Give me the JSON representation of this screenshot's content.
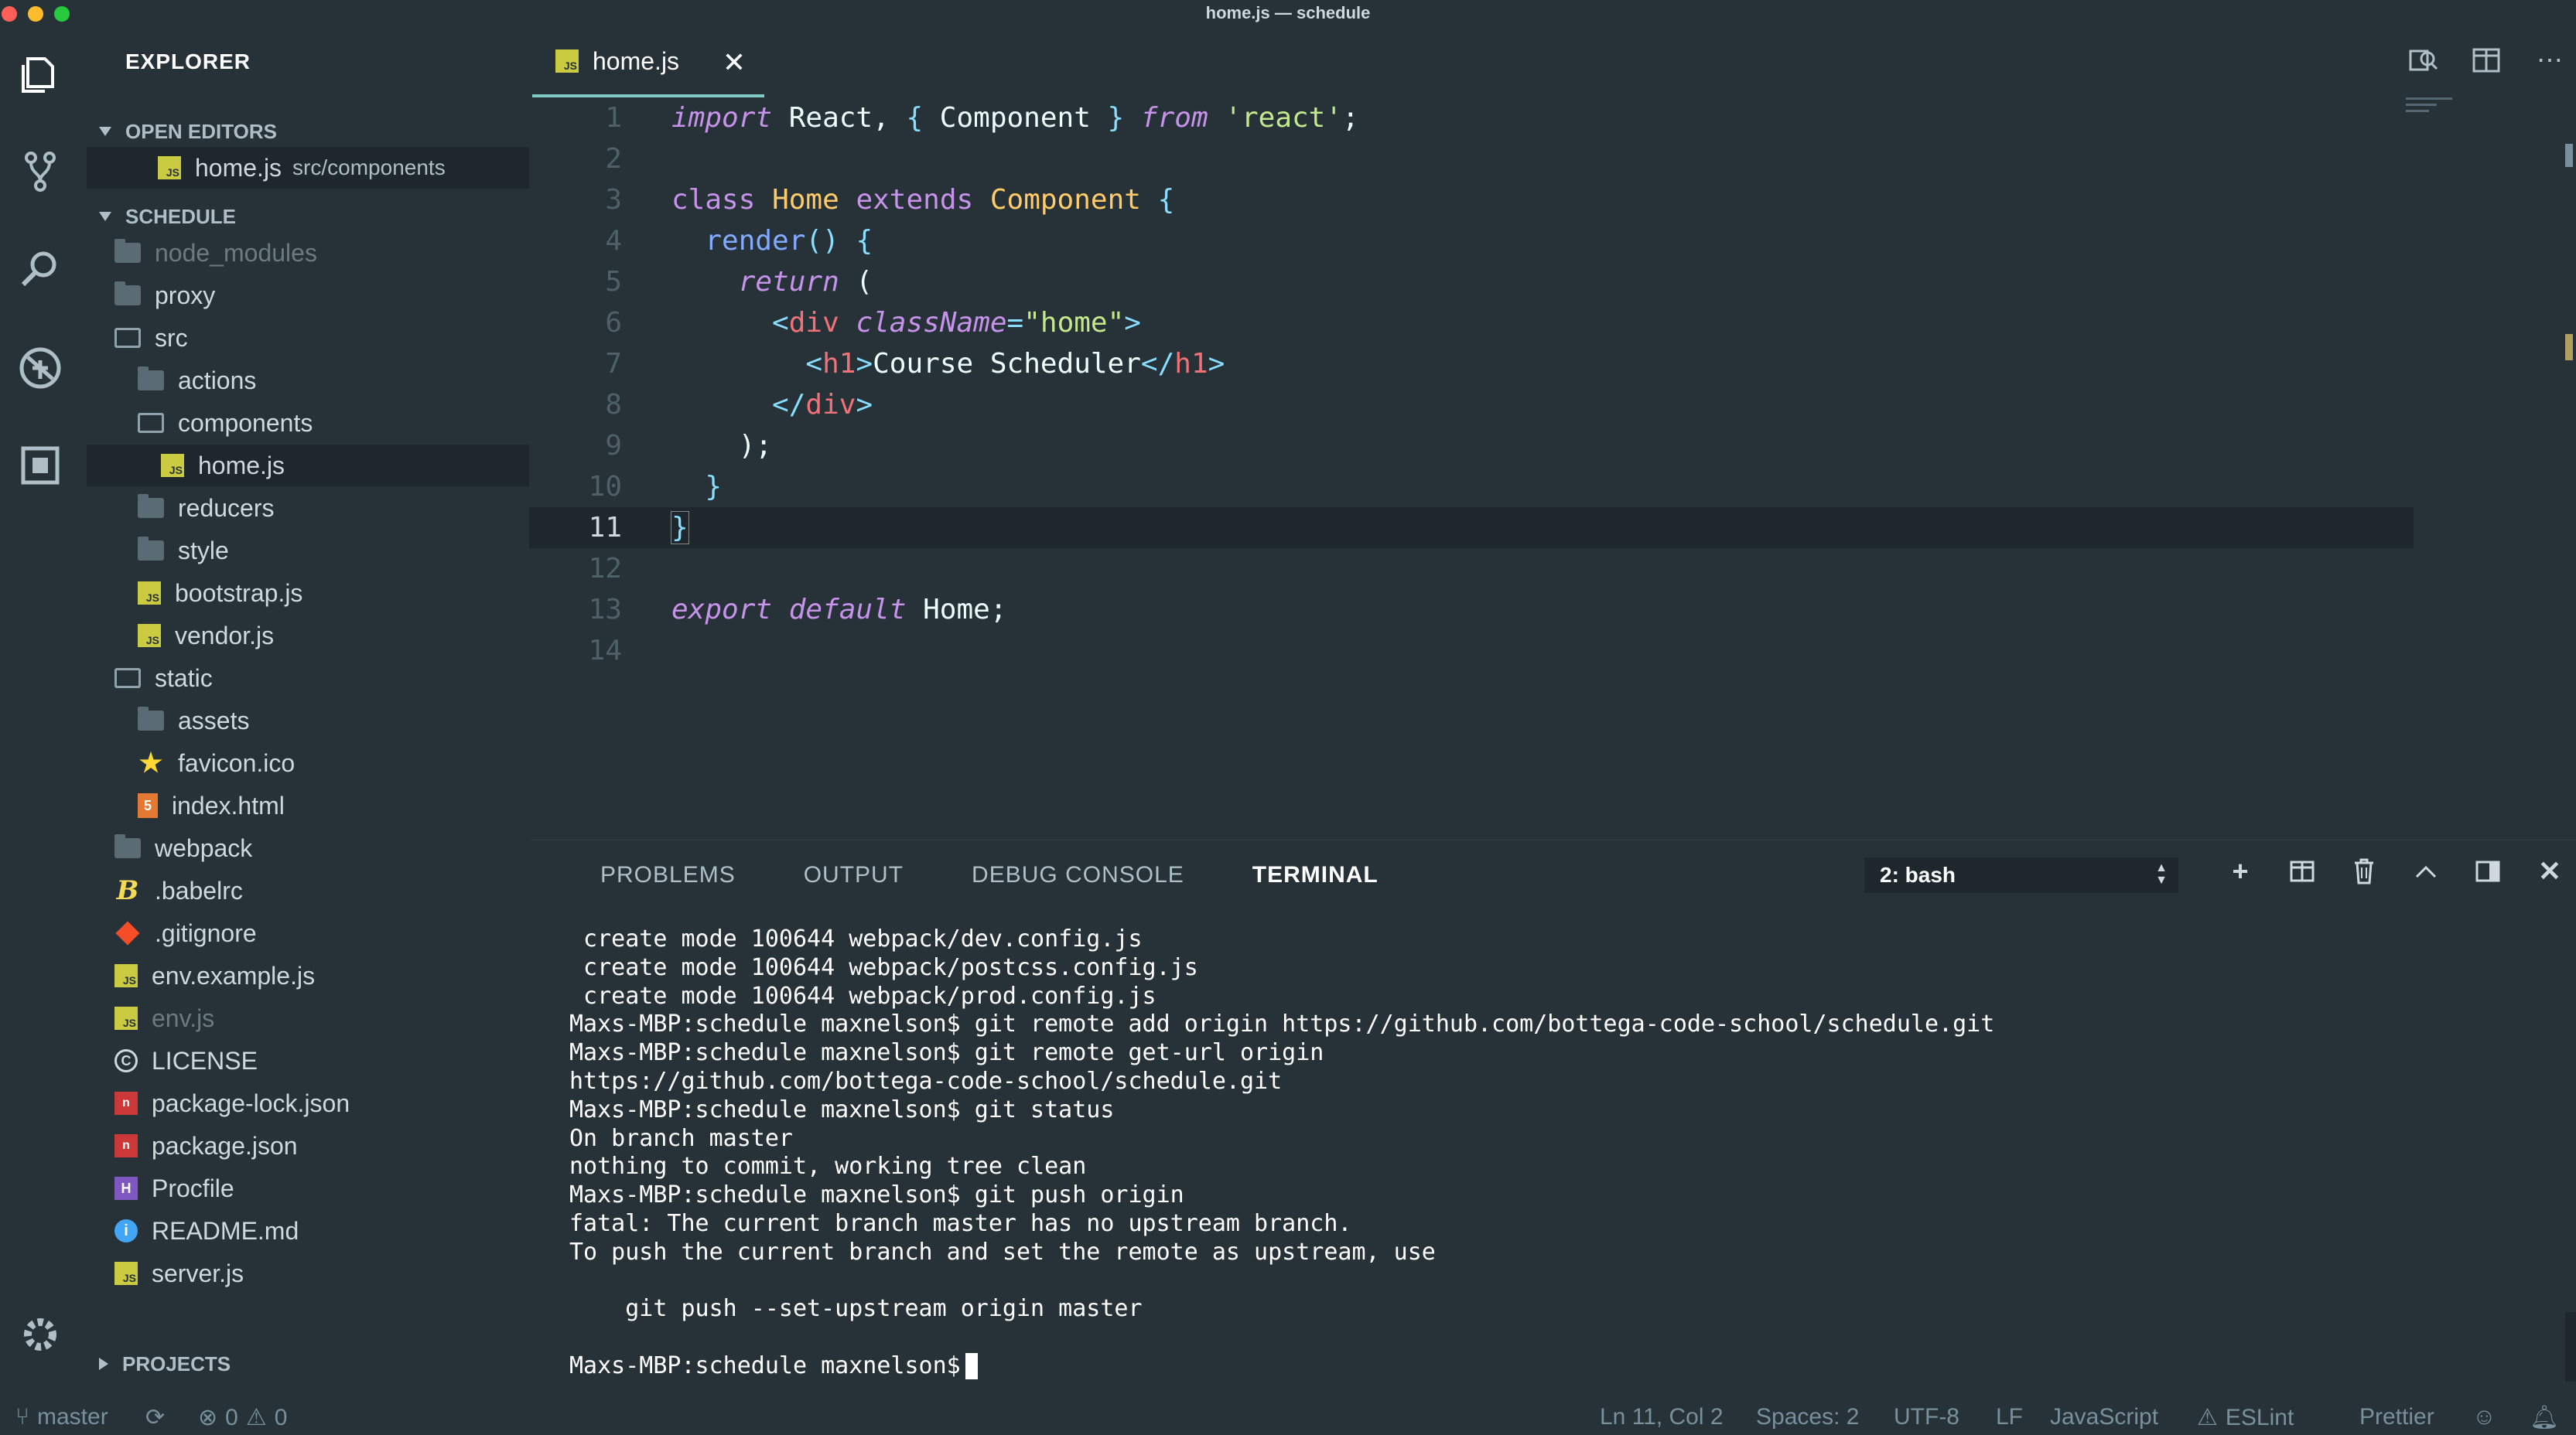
{
  "window": {
    "title": "home.js — schedule"
  },
  "activity_bar": {
    "icons": [
      "files-icon",
      "source-control-icon",
      "search-icon",
      "debug-icon",
      "extensions-icon",
      "settings-gear-icon"
    ]
  },
  "sidebar": {
    "title": "EXPLORER",
    "open_editors": {
      "header": "OPEN EDITORS",
      "items": [
        {
          "name": "home.js",
          "path": "src/components"
        }
      ]
    },
    "project": {
      "header": "SCHEDULE",
      "items": [
        {
          "label": "node_modules",
          "icon": "folder-icon",
          "dim": true
        },
        {
          "label": "proxy",
          "icon": "folder-icon"
        },
        {
          "label": "src",
          "icon": "folder-open-icon"
        },
        {
          "label": "actions",
          "icon": "folder-icon"
        },
        {
          "label": "components",
          "icon": "folder-open-icon"
        },
        {
          "label": "home.js",
          "icon": "js-file-icon",
          "selected": true
        },
        {
          "label": "reducers",
          "icon": "folder-icon"
        },
        {
          "label": "style",
          "icon": "folder-icon"
        },
        {
          "label": "bootstrap.js",
          "icon": "js-file-icon"
        },
        {
          "label": "vendor.js",
          "icon": "js-file-icon"
        },
        {
          "label": "static",
          "icon": "folder-open-icon"
        },
        {
          "label": "assets",
          "icon": "folder-icon"
        },
        {
          "label": "favicon.ico",
          "icon": "star-icon"
        },
        {
          "label": "index.html",
          "icon": "html-file-icon"
        },
        {
          "label": "webpack",
          "icon": "folder-icon"
        },
        {
          "label": ".babelrc",
          "icon": "babel-icon"
        },
        {
          "label": ".gitignore",
          "icon": "git-icon"
        },
        {
          "label": "env.example.js",
          "icon": "js-file-icon"
        },
        {
          "label": "env.js",
          "icon": "js-file-icon",
          "dim": true
        },
        {
          "label": "LICENSE",
          "icon": "license-icon"
        },
        {
          "label": "package-lock.json",
          "icon": "npm-icon"
        },
        {
          "label": "package.json",
          "icon": "npm-icon"
        },
        {
          "label": "Procfile",
          "icon": "procfile-icon"
        },
        {
          "label": "README.md",
          "icon": "info-icon"
        },
        {
          "label": "server.js",
          "icon": "js-file-icon"
        }
      ]
    },
    "projects_header": "PROJECTS"
  },
  "editor": {
    "tab": {
      "label": "home.js",
      "close": "✕"
    },
    "active_line": 11,
    "line_numbers": [
      "1",
      "2",
      "3",
      "4",
      "5",
      "6",
      "7",
      "8",
      "9",
      "10",
      "11",
      "12",
      "13",
      "14"
    ]
  },
  "panel": {
    "tabs": [
      "PROBLEMS",
      "OUTPUT",
      "DEBUG CONSOLE",
      "TERMINAL"
    ],
    "active_tab": "TERMINAL",
    "terminal_select": "2: bash",
    "terminal_lines": [
      " create mode 100644 webpack/dev.config.js",
      " create mode 100644 webpack/postcss.config.js",
      " create mode 100644 webpack/prod.config.js",
      "Maxs-MBP:schedule maxnelson$ git remote add origin https://github.com/bottega-code-school/schedule.git",
      "Maxs-MBP:schedule maxnelson$ git remote get-url origin",
      "https://github.com/bottega-code-school/schedule.git",
      "Maxs-MBP:schedule maxnelson$ git status",
      "On branch master",
      "nothing to commit, working tree clean",
      "Maxs-MBP:schedule maxnelson$ git push origin",
      "fatal: The current branch master has no upstream branch.",
      "To push the current branch and set the remote as upstream, use",
      "",
      "    git push --set-upstream origin master",
      ""
    ],
    "prompt": "Maxs-MBP:schedule maxnelson$"
  },
  "status_bar": {
    "branch": "master",
    "errors": "0",
    "warnings": "0",
    "position": "Ln 11, Col 2",
    "spaces": "Spaces: 2",
    "encoding": "UTF-8",
    "eol": "LF",
    "language": "JavaScript",
    "linter": "ESLint",
    "formatter": "Prettier"
  },
  "colors": {
    "background": "#263238",
    "accent": "#80cbc4",
    "keyword": "#c792ea",
    "class": "#ffcb6b",
    "function": "#82aaff",
    "string": "#c3e88d",
    "tag": "#f07178"
  }
}
